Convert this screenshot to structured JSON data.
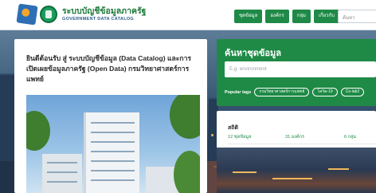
{
  "header": {
    "brand_th": "ระบบบัญชีข้อมูลภาครัฐ",
    "brand_en": "GOVERNMENT DATA CATALOG",
    "nav": [
      "ชุดข้อมูล",
      "องค์กร",
      "กลุ่ม",
      "เกี่ยวกับ"
    ],
    "search_placeholder": "ค้นหา"
  },
  "article": {
    "title": "ยินดีต้อนรับ สู่ ระบบบัญชีข้อมูล (Data Catalog) และการเปิดเผยข้อมูลภาครัฐ (Open Data) กรมวิทยาศาสตร์การแพทย์"
  },
  "search": {
    "title": "ค้นหาชุดข้อมูล",
    "placeholder": "E.g. environment",
    "popular_label": "Popular tags",
    "tags": [
      "กรมวิทยาศาสตร์การแพทย์",
      "โควิด-19",
      "Co-lab2"
    ]
  },
  "stats": {
    "title": "สถิติ",
    "datasets": "12 ชุดข้อมูล",
    "organizations": "31 องค์กร",
    "groups": "6 กลุ่ม"
  },
  "colors": {
    "accent_green": "#1f8a47",
    "brand_blue": "#2b5c8a"
  }
}
